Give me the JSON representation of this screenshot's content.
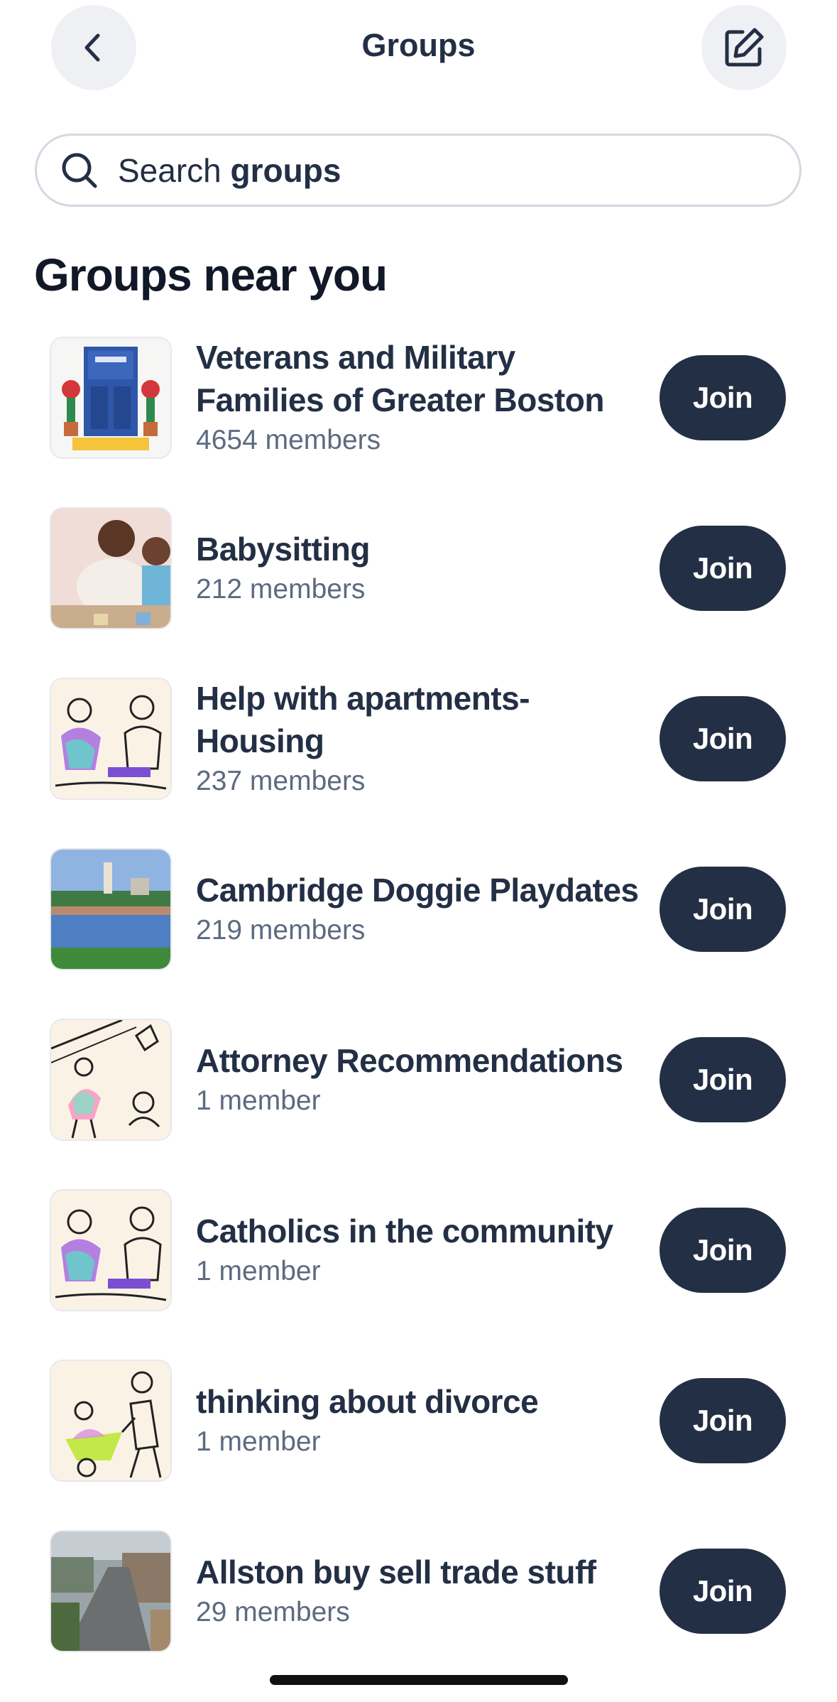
{
  "header": {
    "title": "Groups",
    "back_icon": "chevron-left-icon",
    "edit_icon": "edit-square-icon"
  },
  "search": {
    "placeholder_prefix": "Search ",
    "placeholder_bold": "groups",
    "icon": "search-icon"
  },
  "section": {
    "title": "Groups near you"
  },
  "groups": [
    {
      "name": "Veterans and Military Families of Greater Boston",
      "members": "4654 members",
      "join_label": "Join",
      "thumb": "welcome-door"
    },
    {
      "name": "Babysitting",
      "members": "212 members",
      "join_label": "Join",
      "thumb": "mother-child-photo"
    },
    {
      "name": "Help with apartments-Housing",
      "members": "237 members",
      "join_label": "Join",
      "thumb": "people-illustration"
    },
    {
      "name": "Cambridge Doggie Playdates",
      "members": "219 members",
      "join_label": "Join",
      "thumb": "river-bridge-photo"
    },
    {
      "name": "Attorney Recommendations",
      "members": "1 member",
      "join_label": "Join",
      "thumb": "waving-people-illustration"
    },
    {
      "name": "Catholics in the community",
      "members": "1 member",
      "join_label": "Join",
      "thumb": "people-illustration"
    },
    {
      "name": "thinking about divorce",
      "members": "1 member",
      "join_label": "Join",
      "thumb": "wheelbarrow-illustration"
    },
    {
      "name": "Allston buy sell trade stuff",
      "members": "29 members",
      "join_label": "Join",
      "thumb": "street-aerial-photo"
    }
  ],
  "colors": {
    "primary": "#232f44",
    "muted": "#5d6a80",
    "border": "#d3d8e1",
    "icon_bg": "#eff0f3"
  }
}
